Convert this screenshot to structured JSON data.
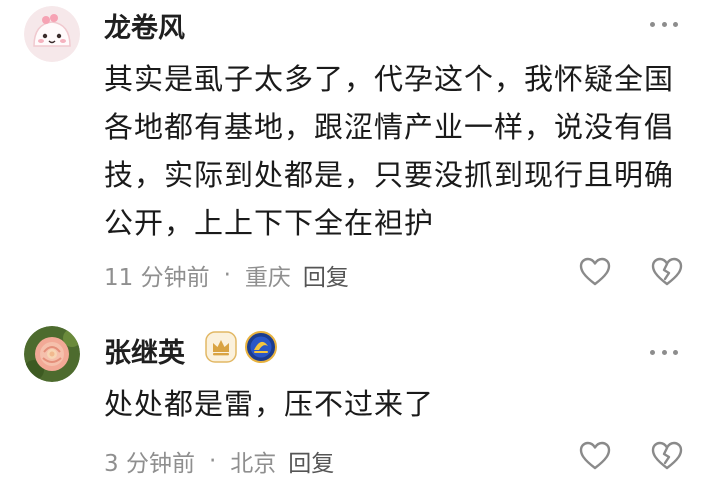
{
  "comments": [
    {
      "username": "龙卷风",
      "text": "其实是虱子太多了，代孕这个，我怀疑全国各地都有基地，跟涩情产业一样，说没有倡技，实际到处都是，只要没抓到现行且明确公开，上上下下全在袒护",
      "time": "11 分钟前",
      "location": "重庆",
      "reply_label": "回复",
      "separator": "·"
    },
    {
      "username": "张继英",
      "text": "处处都是雷，压不过来了",
      "time": "3 分钟前",
      "location": "北京",
      "reply_label": "回复",
      "separator": "·"
    }
  ]
}
